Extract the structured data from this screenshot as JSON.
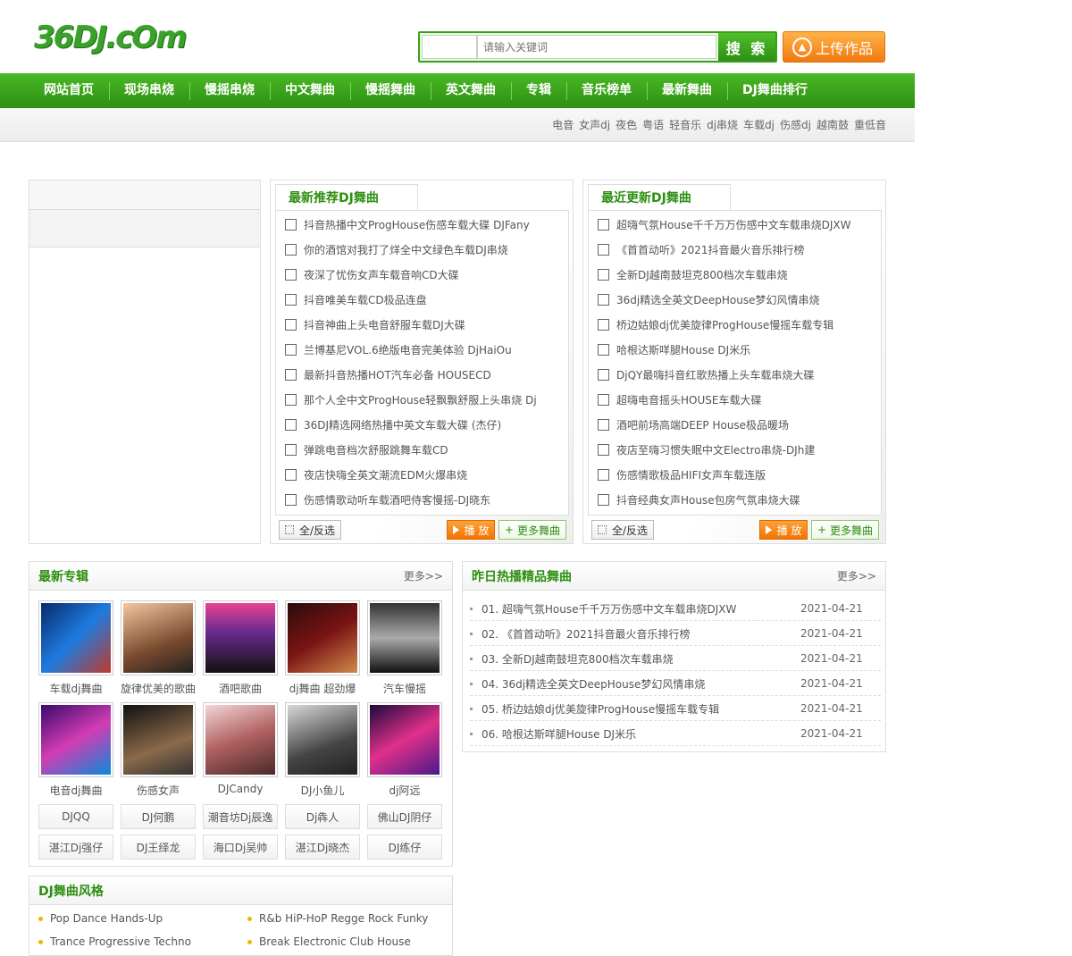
{
  "logo": "36DJ.cOm",
  "search": {
    "placeholder": "请输入关键词",
    "button": "搜 索"
  },
  "upload_label": "上传作品",
  "nav": [
    "网站首页",
    "现场串烧",
    "慢摇串烧",
    "中文舞曲",
    "慢摇舞曲",
    "英文舞曲",
    "专辑",
    "音乐榜单",
    "最新舞曲",
    "DJ舞曲排行"
  ],
  "tags": [
    "电音",
    "女声dj",
    "夜色",
    "粤语",
    "轻音乐",
    "dj串烧",
    "车载dj",
    "伤感dj",
    "越南鼓",
    "重低音"
  ],
  "recommend": {
    "title": "最新推荐DJ舞曲",
    "songs": [
      "抖音热播中文ProgHouse伤感车载大碟 DJFany",
      "你的酒馆对我打了烊全中文绿色车载DJ串烧",
      "夜深了忧伤女声车载音响CD大碟",
      "抖音唯美车载CD极品连盘",
      "抖音神曲上头电音舒服车载DJ大碟",
      "兰博基尼VOL.6绝版电音完美体验 DjHaiOu",
      "最新抖音热播HOT汽车必备 HOUSECD",
      "那个人全中文ProgHouse轻飘飘舒服上头串烧 Dj",
      "36DJ精选网络热播中英文车载大碟 (杰仔)",
      "弹跳电音档次舒服跳舞车载CD",
      "夜店快嗨全英文潮流EDM火爆串烧",
      "伤感情歌动听车载酒吧侍客慢摇-DJ晓东"
    ]
  },
  "latest": {
    "title": "最近更新DJ舞曲",
    "songs": [
      "超嗨气氛House千千万万伤感中文车载串烧DJXW",
      "《首首动听》2021抖音最火音乐排行榜",
      "全新DJ越南鼓坦克800档次车载串烧",
      "36dj精选全英文DeepHouse梦幻风情串烧",
      "桥边姑娘dj优美旋律ProgHouse慢摇车载专辑",
      "哈根达斯咩腿House DJ米乐",
      "DjQY最嗨抖音红歌热播上头车载串烧大碟",
      "超嗨电音摇头HOUSE车载大碟",
      "酒吧前场高端DEEP House极品暖场",
      "夜店至嗨习惯失眠中文Electro串烧-DJh建",
      "伤感情歌极品HIFI女声车载连版",
      "抖音经典女声House包房气氛串烧大碟"
    ]
  },
  "buttons": {
    "select_all": "全/反选",
    "play": "播 放",
    "more": "更多舞曲"
  },
  "albums": {
    "title": "最新专辑",
    "more": "更多>>",
    "items": [
      "车载dj舞曲",
      "旋律优美的歌曲",
      "酒吧歌曲",
      "dj舞曲 超劲爆",
      "汽车慢摇",
      "电音dj舞曲",
      "伤感女声",
      "DJCandy",
      "DJ小鱼儿",
      "dj阿远"
    ],
    "djs": [
      "DJQQ",
      "DJ何鹏",
      "潮音坊Dj辰逸",
      "Dj犇人",
      "佛山DJ阴仔",
      "湛江Dj强仔",
      "DJ王绎龙",
      "海口Dj吴帅",
      "湛江Dj晓杰",
      "DJ练仔"
    ]
  },
  "hot": {
    "title": "昨日热播精品舞曲",
    "more": "更多>>",
    "rows": [
      {
        "t": "01. 超嗨气氛House千千万万伤感中文车载串烧DJXW",
        "d": "2021-04-21"
      },
      {
        "t": "02. 《首首动听》2021抖音最火音乐排行榜",
        "d": "2021-04-21"
      },
      {
        "t": "03. 全新DJ越南鼓坦克800档次车载串烧",
        "d": "2021-04-21"
      },
      {
        "t": "04. 36dj精选全英文DeepHouse梦幻风情串烧",
        "d": "2021-04-21"
      },
      {
        "t": "05. 桥边姑娘dj优美旋律ProgHouse慢摇车载专辑",
        "d": "2021-04-21"
      },
      {
        "t": "06. 哈根达斯咩腿House DJ米乐",
        "d": "2021-04-21"
      }
    ]
  },
  "styles": {
    "title": "DJ舞曲风格",
    "items": [
      "Pop Dance Hands-Up",
      "R&b HiP-HoP Regge Rock Funky",
      "Trance Progressive Techno",
      "Break Electronic Club House"
    ]
  }
}
